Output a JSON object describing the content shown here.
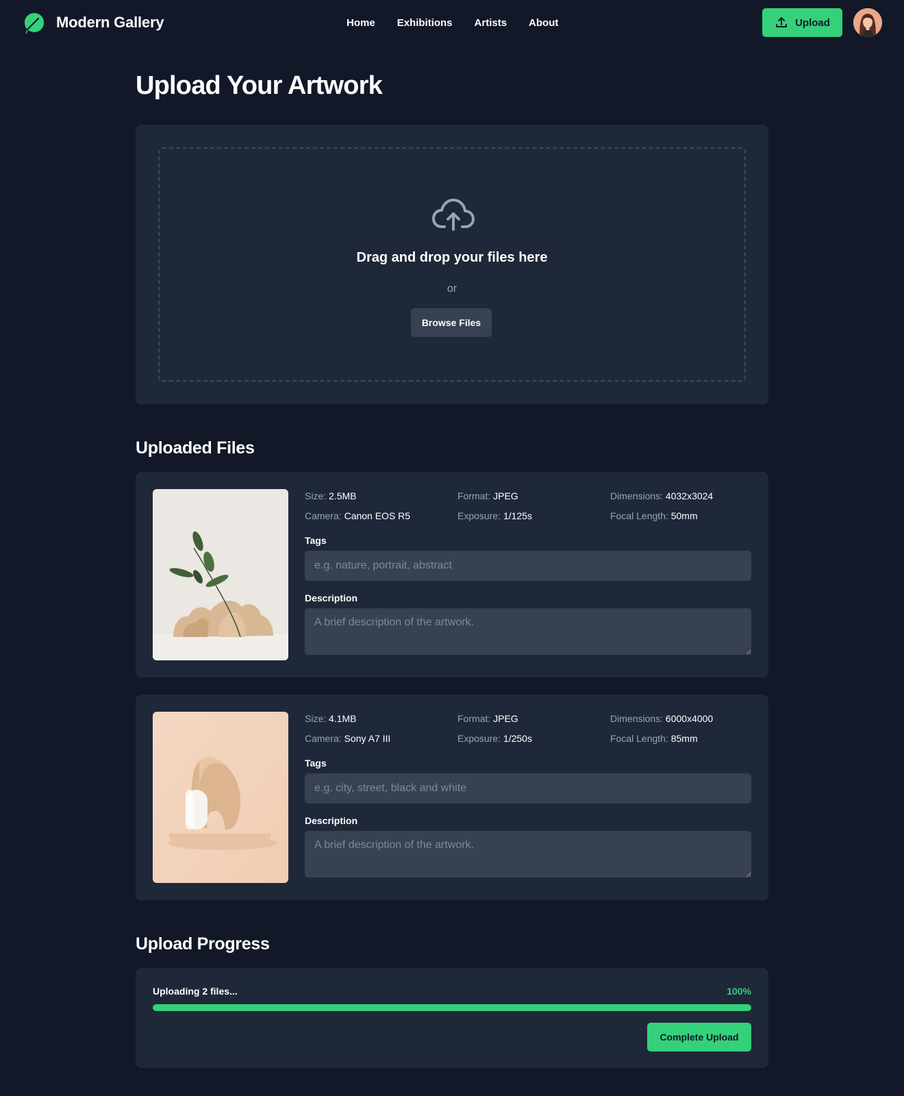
{
  "brand": {
    "name": "Modern Gallery",
    "logo_icon": "leaf-logo-icon"
  },
  "nav": {
    "items": [
      "Home",
      "Exhibitions",
      "Artists",
      "About"
    ]
  },
  "header": {
    "upload_label": "Upload",
    "upload_icon": "upload-icon"
  },
  "page": {
    "title": "Upload Your Artwork"
  },
  "dropzone": {
    "icon": "cloud-upload-icon",
    "title": "Drag and drop your files here",
    "or": "or",
    "browse_label": "Browse Files"
  },
  "uploaded": {
    "title": "Uploaded Files",
    "files": [
      {
        "size_label": "Size:",
        "size": "2.5MB",
        "format_label": "Format:",
        "format": "JPEG",
        "dimensions_label": "Dimensions:",
        "dimensions": "4032x3024",
        "camera_label": "Camera:",
        "camera": "Canon EOS R5",
        "exposure_label": "Exposure:",
        "exposure": "1/125s",
        "focal_label": "Focal Length:",
        "focal": "50mm",
        "tags_label": "Tags",
        "tags_placeholder": "e.g. nature, portrait, abstract",
        "tags_value": "",
        "description_label": "Description",
        "description_placeholder": "A brief description of the artwork.",
        "description_value": ""
      },
      {
        "size_label": "Size:",
        "size": "4.1MB",
        "format_label": "Format:",
        "format": "JPEG",
        "dimensions_label": "Dimensions:",
        "dimensions": "6000x4000",
        "camera_label": "Camera:",
        "camera": "Sony A7 III",
        "exposure_label": "Exposure:",
        "exposure": "1/250s",
        "focal_label": "Focal Length:",
        "focal": "85mm",
        "tags_label": "Tags",
        "tags_placeholder": "e.g. city, street, black and white",
        "tags_value": "",
        "description_label": "Description",
        "description_placeholder": "A brief description of the artwork.",
        "description_value": ""
      }
    ]
  },
  "progress": {
    "title": "Upload Progress",
    "status": "Uploading 2 files...",
    "percent_label": "100%",
    "percent": 100,
    "complete_label": "Complete Upload"
  },
  "colors": {
    "background": "#121828",
    "card": "#1f2838",
    "input": "#374151",
    "accent": "#34d17a",
    "muted_text": "#9aa3b2"
  }
}
